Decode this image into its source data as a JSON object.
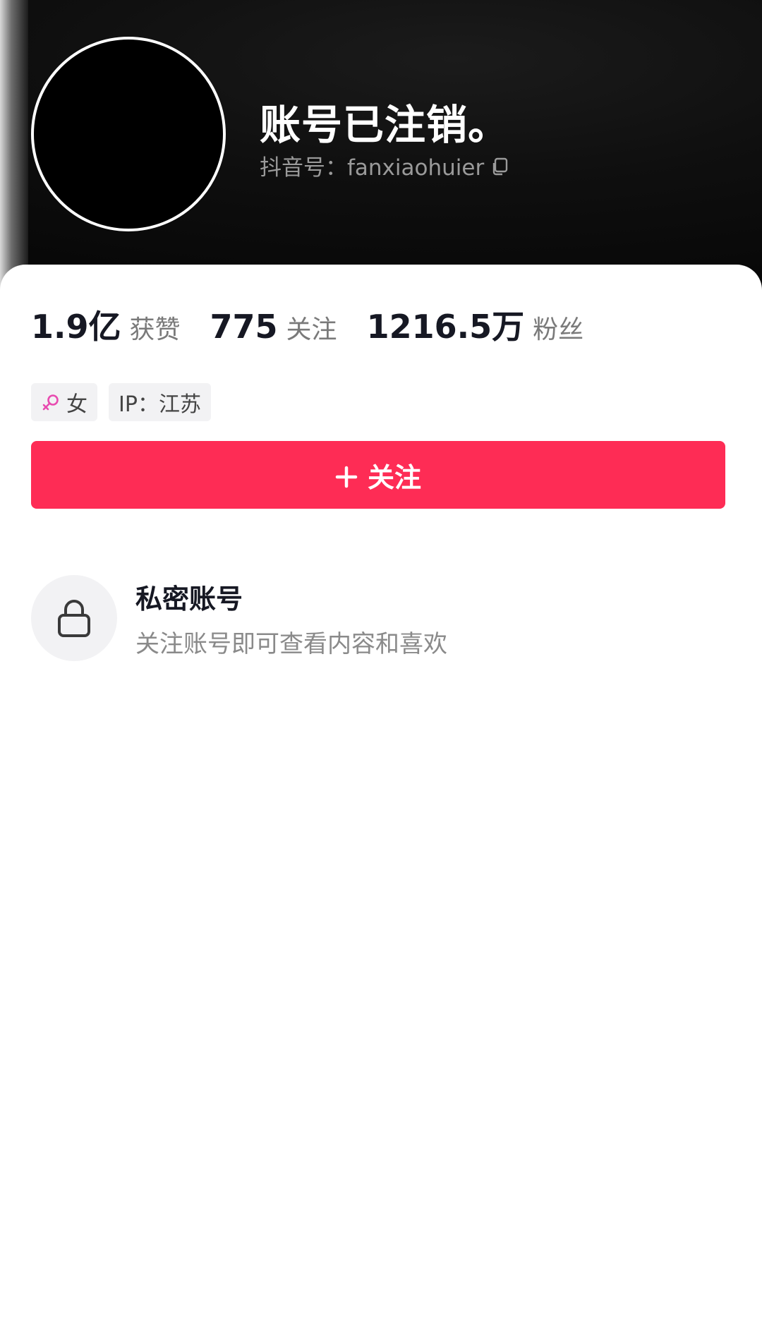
{
  "profile": {
    "display_name": "账号已注销。",
    "handle_label": "抖音号：fanxiaohuier"
  },
  "stats": [
    {
      "value": "1.9亿",
      "label": "获赞"
    },
    {
      "value": "775",
      "label": "关注"
    },
    {
      "value": "1216.5万",
      "label": "粉丝"
    }
  ],
  "tags": {
    "gender": "女",
    "ip": "IP：江苏"
  },
  "follow_button": {
    "label": "关注"
  },
  "private": {
    "title": "私密账号",
    "description": "关注账号即可查看内容和喜欢"
  },
  "colors": {
    "accent": "#fe2c55",
    "female": "#e84bb0",
    "header_bg": "#0f0f0f"
  },
  "icons": {
    "copy": "copy-icon",
    "female": "female-icon",
    "plus": "plus-icon",
    "lock": "lock-icon"
  }
}
